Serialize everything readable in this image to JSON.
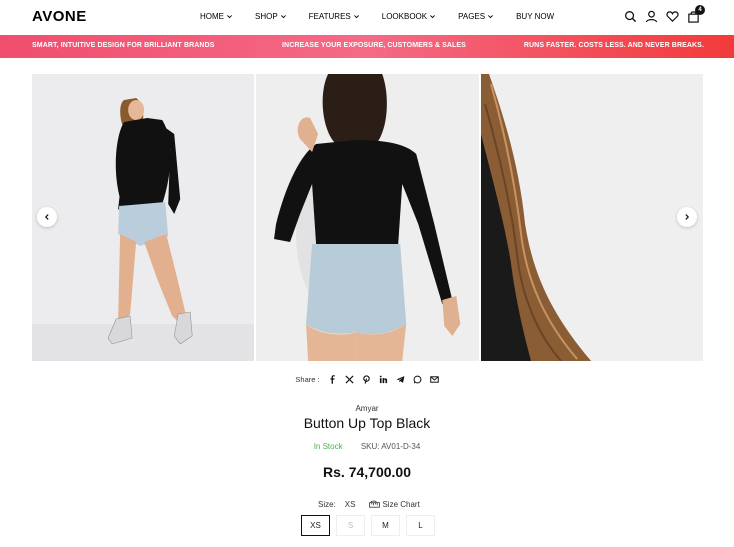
{
  "header": {
    "logo": "AVONE",
    "nav": [
      {
        "label": "HOME",
        "dropdown": true
      },
      {
        "label": "SHOP",
        "dropdown": true
      },
      {
        "label": "FEATURES",
        "dropdown": true
      },
      {
        "label": "LOOKBOOK",
        "dropdown": true
      },
      {
        "label": "PAGES",
        "dropdown": true
      },
      {
        "label": "BUY NOW",
        "dropdown": false
      }
    ],
    "cart_count": "4",
    "icons": [
      "search-icon",
      "account-icon",
      "wishlist-icon",
      "cart-icon"
    ]
  },
  "promo": {
    "left": "SMART, INTUITIVE DESIGN FOR BRILLIANT BRANDS",
    "center": "INCREASE YOUR EXPOSURE, CUSTOMERS & SALES",
    "right": "RUNS FASTER. COSTS LESS. AND NEVER BREAKS."
  },
  "share": {
    "label": "Share :",
    "icons": [
      "facebook-icon",
      "x-icon",
      "pinterest-icon",
      "linkedin-icon",
      "telegram-icon",
      "whatsapp-icon",
      "email-icon"
    ]
  },
  "product": {
    "vendor": "Amyar",
    "title": "Button Up Top Black",
    "stock": "In Stock",
    "sku": "SKU: AV01-D-34",
    "price": "Rs. 74,700.00",
    "size_label": "Size:",
    "selected_size": "XS",
    "size_chart_label": "Size Chart",
    "sizes": [
      {
        "label": "XS",
        "state": "active"
      },
      {
        "label": "S",
        "state": "disabled"
      },
      {
        "label": "M",
        "state": "available"
      },
      {
        "label": "L",
        "state": "available"
      }
    ]
  },
  "colors": {
    "promo_start": "#f04e6e",
    "promo_end": "#f23a3a",
    "stock_green": "#4caf50"
  }
}
